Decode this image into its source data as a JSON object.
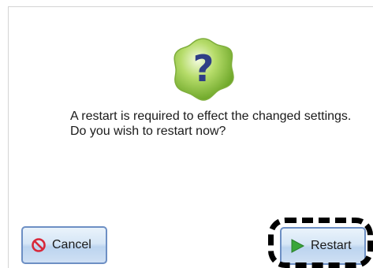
{
  "dialog": {
    "message": "A restart is required to effect the changed settings. Do you wish to restart now?",
    "icon": "question-icon"
  },
  "buttons": {
    "cancel_label": "Cancel",
    "cancel_icon": "no-entry-icon",
    "restart_label": "Restart",
    "restart_icon": "play-arrow-icon"
  },
  "colors": {
    "icon_green": "#8cc63f",
    "icon_mark": "#2f3e86",
    "cancel_icon": "#d8283a",
    "restart_icon": "#3aa63a",
    "button_border": "#6d8fc4"
  }
}
